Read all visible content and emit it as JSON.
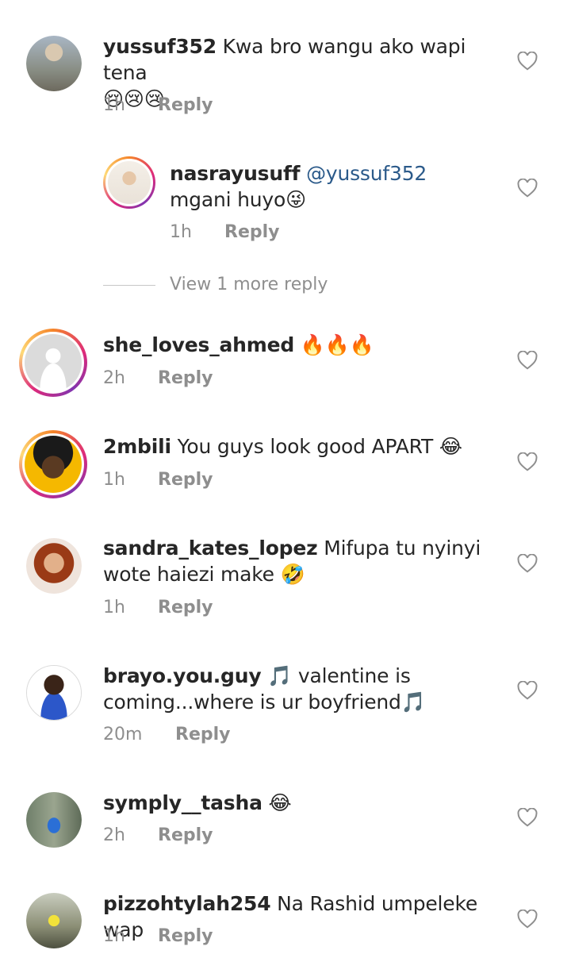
{
  "comments": [
    {
      "username": "yussuf352",
      "text": "Kwa bro wangu ako wapi tena",
      "emoji": "😢😢😢",
      "time": "1h",
      "reply": "Reply"
    },
    {
      "username": "nasrayusuff",
      "mention": "@yussuf352",
      "text": "mgani huyo",
      "emoji": "😜",
      "time": "1h",
      "reply": "Reply"
    },
    {
      "username": "she_loves_ahmed",
      "text": "",
      "emoji": "🔥🔥🔥",
      "time": "2h",
      "reply": "Reply"
    },
    {
      "username": "2mbili",
      "text": "You guys look good APART",
      "emoji": "😂",
      "time": "1h",
      "reply": "Reply"
    },
    {
      "username": "sandra_kates_lopez",
      "text": "Mifupa tu nyinyi wote haiezi make",
      "emoji": "🤣",
      "time": "1h",
      "reply": "Reply"
    },
    {
      "username": "brayo.you.guy",
      "text": "valentine is coming...where is ur boyfriend",
      "emoji": "🎵",
      "time": "20m",
      "reply": "Reply"
    },
    {
      "username": "symply__tasha",
      "text": "",
      "emoji": "😂",
      "time": "2h",
      "reply": "Reply"
    },
    {
      "username": "pizzohtylah254",
      "text": "Na Rashid umpeleke wap",
      "emoji": "",
      "time": "1h",
      "reply": "Reply"
    }
  ],
  "view_more": "View 1 more reply",
  "colors": {
    "mention": "#2b5a8a",
    "meta": "#8e8e8e",
    "ring": "#dd2a7b"
  },
  "icons": {
    "like": "heart-outline-icon"
  }
}
